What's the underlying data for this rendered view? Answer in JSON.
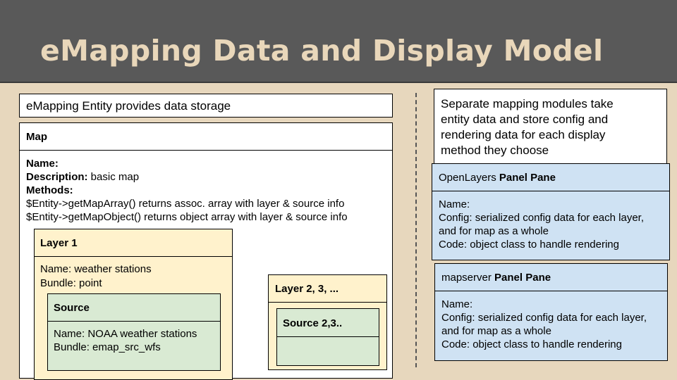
{
  "title": "eMapping Data and Display Model",
  "entity_caption": "eMapping Entity provides data storage",
  "map": {
    "heading": "Map",
    "name_label": "Name:",
    "description_label": "Description:",
    "description_value": " basic map",
    "methods_label": "Methods:",
    "method_1": "$Entity->getMapArray() returns assoc. array with layer & source info",
    "method_2": "$Entity->getMapObject() returns object array with layer & source info"
  },
  "layer1": {
    "heading": "Layer 1",
    "name": "Name: weather stations",
    "bundle": "Bundle: point"
  },
  "source1": {
    "heading": "Source",
    "name": "Name: NOAA weather stations",
    "bundle": "Bundle: emap_src_wfs"
  },
  "layer2": {
    "heading": "Layer 2, 3, ..."
  },
  "source2": {
    "heading": "Source 2,3.."
  },
  "modules_caption": [
    "Separate mapping modules take",
    "entity data and store config and",
    "rendering data for each display",
    "method they choose"
  ],
  "openlayers": {
    "heading_plain": "OpenLayers ",
    "heading_bold": "Panel Pane",
    "name": "Name:",
    "config_1": "Config: serialized config data for each layer,",
    "config_2": "and for map as a whole",
    "code": "Code: object class to handle rendering"
  },
  "mapserver": {
    "heading_plain": "mapserver ",
    "heading_bold": "Panel Pane",
    "name": "Name:",
    "config_1": "Config: serialized config data for each layer,",
    "config_2": "and for map as a whole",
    "code": "Code: object class to handle rendering"
  },
  "colors": {
    "background": "#e7d7bd",
    "header": "#595959",
    "title": "#e9d7ba",
    "layer_fill": "#fff2cc",
    "source_fill": "#d9ead3",
    "panel_fill": "#cfe2f3"
  }
}
